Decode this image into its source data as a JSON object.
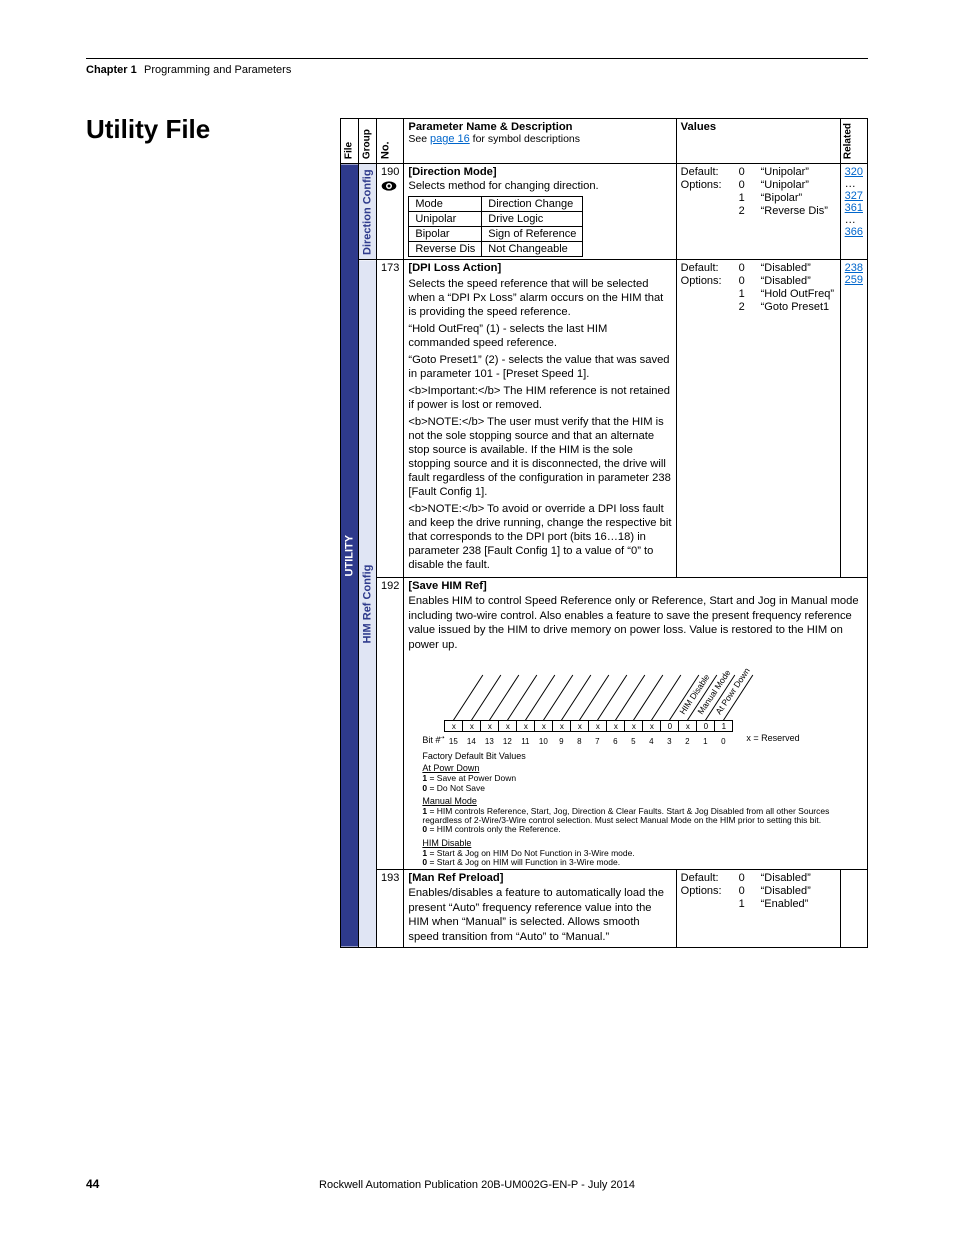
{
  "header": {
    "chapter_label": "Chapter 1",
    "chapter_title": "Programming and Parameters"
  },
  "footer": {
    "page": "44",
    "pub": "Rockwell Automation Publication 20B-UM002G-EN-P - July 2014"
  },
  "section_title": "Utility File",
  "columns": {
    "file": "File",
    "group": "Group",
    "no": "No.",
    "param": "Parameter Name & Description",
    "param_sub_a": "See ",
    "param_sub_link": "page 16",
    "param_sub_b": " for symbol descriptions",
    "values": "Values",
    "related": "Related"
  },
  "file_label": "UTILITY",
  "groups": {
    "direction": "Direction Config",
    "him": "HIM Ref Config"
  },
  "rows": {
    "p190": {
      "no": "190",
      "name": "[Direction Mode]",
      "intro": "Selects method for changing direction.",
      "tbl": {
        "h1": "Mode",
        "h2": "Direction Change",
        "r": [
          [
            "Unipolar",
            "Drive Logic"
          ],
          [
            "Bipolar",
            "Sign of Reference"
          ],
          [
            "Reverse Dis",
            "Not Changeable"
          ]
        ]
      },
      "values": {
        "default": {
          "lbl": "Default:",
          "n": "0",
          "t": "“Unipolar”"
        },
        "options": [
          {
            "lbl": "Options:",
            "n": "0",
            "t": "“Unipolar”"
          },
          {
            "lbl": "",
            "n": "1",
            "t": "“Bipolar”"
          },
          {
            "lbl": "",
            "n": "2",
            "t": "“Reverse Dis”"
          }
        ]
      },
      "related": [
        "320",
        "…",
        "327",
        "361",
        "…",
        "366"
      ]
    },
    "p173": {
      "no": "173",
      "name": "[DPI Loss Action]",
      "desc": [
        "Selects the speed reference that will be selected when a “DPI Px Loss” alarm occurs on the HIM that is providing the speed reference.",
        "“Hold OutFreq” (1) - selects the last HIM commanded speed reference.",
        "“Goto Preset1” (2) - selects the value that was saved in parameter 101 - [Preset Speed 1].",
        "<b>Important:</b> The HIM reference is not retained if power is lost or removed.",
        "<b>NOTE:</b> The user must verify that the HIM is not the sole stopping source and that an alternate stop source is available. If the HIM is the sole stopping source and it is disconnected, the drive will fault regardless of the configuration in parameter 238 [Fault Config 1].",
        "<b>NOTE:</b> To avoid or override a DPI loss fault and keep the drive running, change the respective bit that corresponds to the DPI port (bits 16…18) in parameter 238 [Fault Config 1] to a value of “0” to disable the fault."
      ],
      "values": {
        "default": {
          "lbl": "Default:",
          "n": "0",
          "t": "“Disabled”"
        },
        "options": [
          {
            "lbl": "Options:",
            "n": "0",
            "t": "“Disabled”"
          },
          {
            "lbl": "",
            "n": "1",
            "t": "“Hold OutFreq”"
          },
          {
            "lbl": "",
            "n": "2",
            "t": "“Goto Preset1"
          }
        ]
      },
      "related": [
        "238",
        "259"
      ]
    },
    "p192": {
      "no": "192",
      "name": "[Save HIM Ref]",
      "intro": "Enables HIM to control Speed Reference only or Reference, Start and Jog in Manual mode including two-wire control. Also enables a feature to save the present frequency reference value issued by the HIM to drive memory on power loss. Value is restored to the HIM on power up.",
      "bits": {
        "labels": [
          "15",
          "14",
          "13",
          "12",
          "11",
          "10",
          "9",
          "8",
          "7",
          "6",
          "5",
          "4",
          "3",
          "2",
          "1",
          "0"
        ],
        "vals": [
          "x",
          "x",
          "x",
          "x",
          "x",
          "x",
          "x",
          "x",
          "x",
          "x",
          "x",
          "x",
          "0",
          "x",
          "0",
          "1"
        ],
        "diag": [
          "HIM Disable",
          "Manual Mode",
          "At Powr Down"
        ],
        "bit_hash": "Bit #",
        "factory": "Factory Default Bit Values",
        "reserved": "x = Reserved",
        "sections": [
          {
            "head": "At Powr Down",
            "lines": [
              {
                "b": "1",
                "eq": " = Save at Power Down"
              },
              {
                "b": "0",
                "eq": " = Do Not Save"
              }
            ]
          },
          {
            "head": "Manual Mode",
            "lines": [
              {
                "b": "1",
                "eq": " = HIM controls Reference, Start, Jog, Direction & Clear Faults. Start & Jog Disabled from all other Sources regardless of 2-Wire/3-Wire control selection. Must select Manual Mode on the HIM prior to setting this bit."
              },
              {
                "b": "0",
                "eq": " = HIM controls only the Reference."
              }
            ]
          },
          {
            "head": "HIM Disable",
            "lines": [
              {
                "b": "1",
                "eq": " = Start & Jog on HIM Do Not Function in 3-Wire mode."
              },
              {
                "b": "0",
                "eq": " = Start & Jog on HIM will Function in 3-Wire mode."
              }
            ]
          }
        ]
      }
    },
    "p193": {
      "no": "193",
      "name": "[Man Ref Preload]",
      "desc": "Enables/disables a feature to automatically load the present “Auto” frequency reference value into the HIM when “Manual” is selected. Allows smooth speed transition from “Auto” to “Manual.”",
      "values": {
        "default": {
          "lbl": "Default:",
          "n": "0",
          "t": "“Disabled”"
        },
        "options": [
          {
            "lbl": "Options:",
            "n": "0",
            "t": "“Disabled”"
          },
          {
            "lbl": "",
            "n": "1",
            "t": "“Enabled”"
          }
        ]
      }
    }
  }
}
